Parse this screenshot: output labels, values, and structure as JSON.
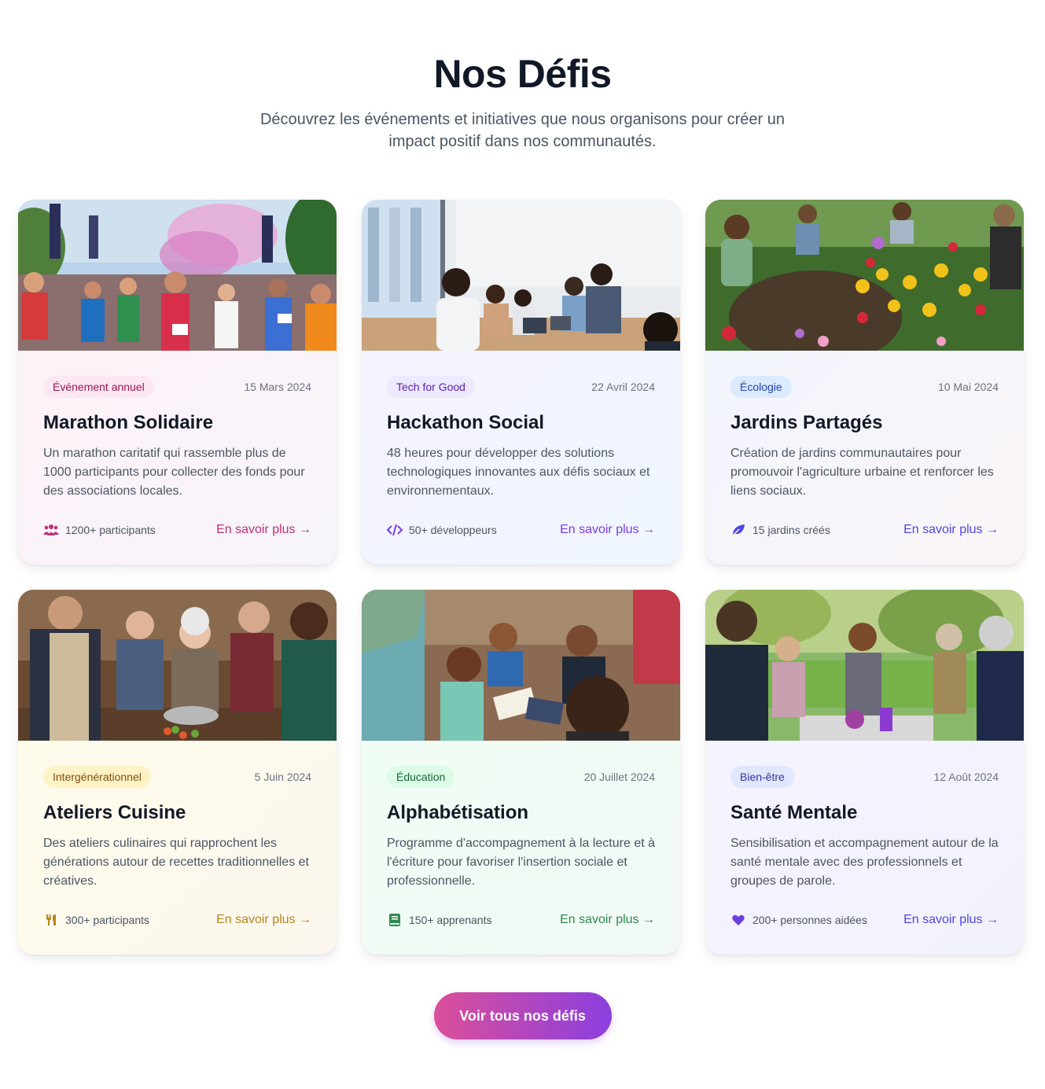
{
  "header": {
    "title": "Nos Défis",
    "subtitle": "Découvrez les événements et initiatives que nous organisons pour créer un impact positif dans nos communautés."
  },
  "cards": [
    {
      "image": "marathon-runners-photo",
      "badge": "Événement annuel",
      "date": "15 Mars 2024",
      "title": "Marathon Solidaire",
      "description": "Un marathon caritatif qui rassemble plus de 1000 participants pour collecter des fonds pour des associations locales.",
      "stat_icon": "users-icon",
      "stat": "1200+ participants",
      "link": "En savoir plus →",
      "accent": "#be2f7a"
    },
    {
      "image": "hackathon-team-photo",
      "badge": "Tech for Good",
      "date": "22 Avril 2024",
      "title": "Hackathon Social",
      "description": "48 heures pour développer des solutions technologiques innovantes aux défis sociaux et environnementaux.",
      "stat_icon": "code-icon",
      "stat": "50+ développeurs",
      "link": "En savoir plus →",
      "accent": "#7c3aed"
    },
    {
      "image": "community-garden-photo",
      "badge": "Écologie",
      "date": "10 Mai 2024",
      "title": "Jardins Partagés",
      "description": "Création de jardins communautaires pour promouvoir l'agriculture urbaine et renforcer les liens sociaux.",
      "stat_icon": "leaf-icon",
      "stat": "15 jardins créés",
      "link": "En savoir plus →",
      "accent": "#4f46e5"
    },
    {
      "image": "cooking-workshop-photo",
      "badge": "Intergénérationnel",
      "date": "5 Juin 2024",
      "title": "Ateliers Cuisine",
      "description": "Des ateliers culinaires qui rapprochent les générations autour de recettes traditionnelles et créatives.",
      "stat_icon": "utensils-icon",
      "stat": "300+ participants",
      "link": "En savoir plus →",
      "accent": "#b7841c"
    },
    {
      "image": "children-reading-photo",
      "badge": "Éducation",
      "date": "20 Juillet 2024",
      "title": "Alphabétisation",
      "description": "Programme d'accompagnement à la lecture et à l'écriture pour favoriser l'insertion sociale et professionnelle.",
      "stat_icon": "book-icon",
      "stat": "150+ apprenants",
      "link": "En savoir plus →",
      "accent": "#2f8a4e"
    },
    {
      "image": "support-group-park-photo",
      "badge": "Bien-être",
      "date": "12 Août 2024",
      "title": "Santé Mentale",
      "description": "Sensibilisation et accompagnement autour de la santé mentale avec des professionnels et groupes de parole.",
      "stat_icon": "heart-icon",
      "stat": "200+ personnes aidées",
      "link": "En savoir plus →",
      "accent": "#4f46e5"
    }
  ],
  "cta": {
    "label": "Voir tous nos défis"
  }
}
